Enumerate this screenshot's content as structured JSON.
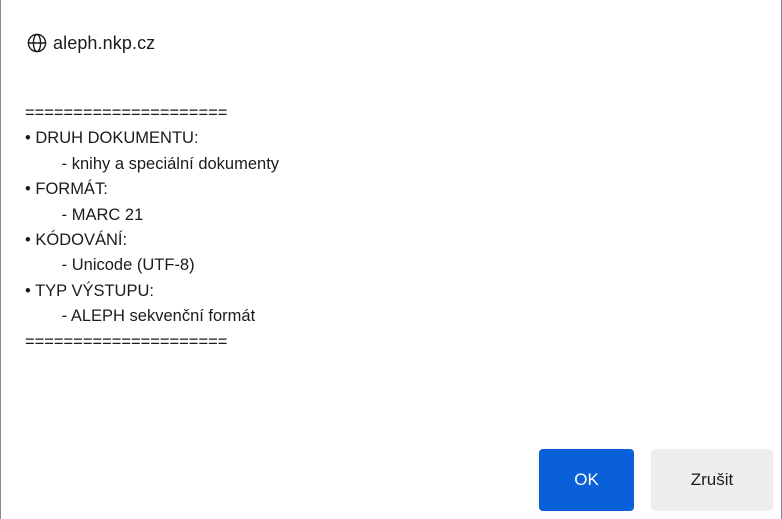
{
  "dialog": {
    "origin": "aleph.nkp.cz",
    "origin_icon": "globe-icon",
    "message_lines": [
      "=====================",
      "• DRUH DOKUMENTU:",
      "        - knihy a speciální dokumenty",
      "• FORMÁT:",
      "        - MARC 21",
      "• KÓDOVÁNÍ:",
      "        - Unicode (UTF-8)",
      "• TYP VÝSTUPU:",
      "        - ALEPH sekvenční formát",
      "====================="
    ],
    "ok_label": "OK",
    "cancel_label": "Zrušit"
  },
  "colors": {
    "ok_button": "#0a60d8",
    "cancel_button": "#eeeeee",
    "text": "#1b1b1b",
    "border": "#8a8a8a"
  }
}
